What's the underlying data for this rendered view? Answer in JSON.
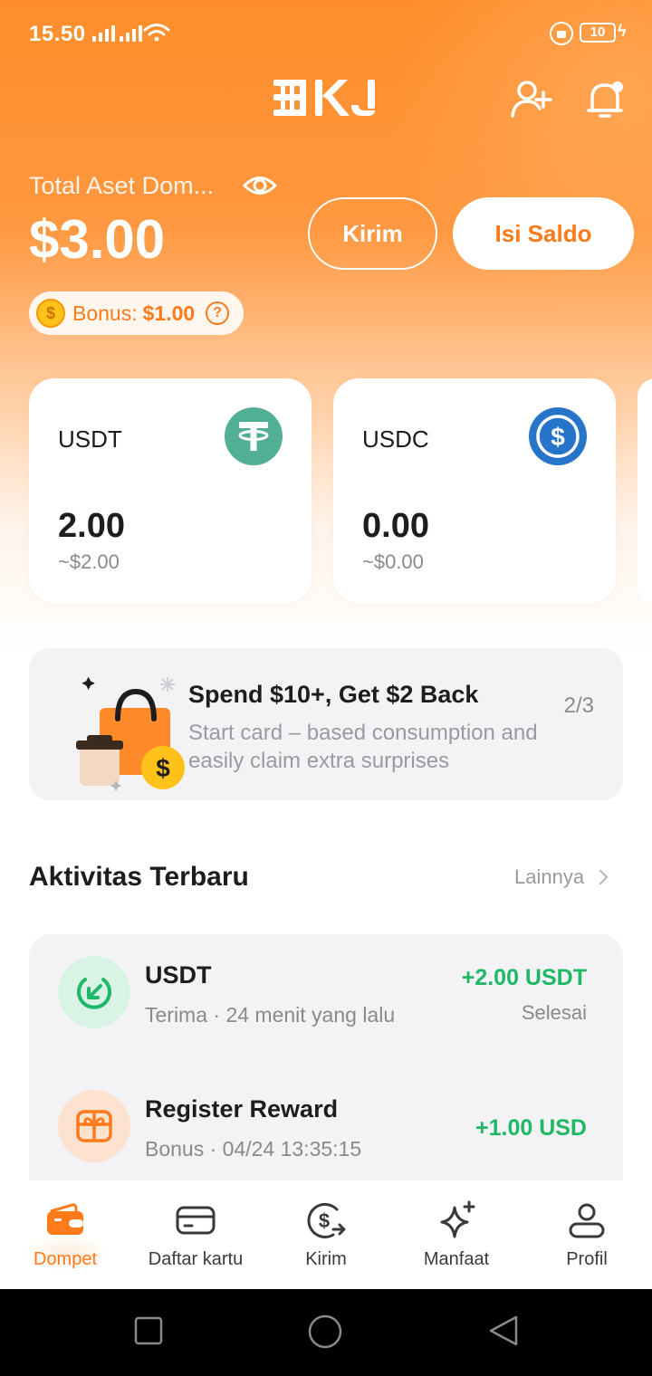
{
  "status_bar": {
    "time": "15.50",
    "battery": "10"
  },
  "header": {
    "logo_text": "BKJ",
    "add_user_icon": "add-user-icon",
    "bell_icon": "bell-icon"
  },
  "wallet": {
    "total_label": "Total Aset Dom...",
    "total_value": "$3.00",
    "send_label": "Kirim",
    "topup_label": "Isi Saldo",
    "bonus_label": "Bonus:",
    "bonus_value": "$1.00",
    "coin_symbol": "$",
    "help_symbol": "?"
  },
  "coins": [
    {
      "name": "USDT",
      "amount": "2.00",
      "usd": "~$2.00",
      "color": "#50af95"
    },
    {
      "name": "USDC",
      "amount": "0.00",
      "usd": "~$0.00",
      "color": "#2775ca"
    }
  ],
  "promo": {
    "title": "Spend $10+, Get $2 Back",
    "subtitle": "Start card – based consumption and easily claim extra surprises",
    "page": "2/3"
  },
  "activity": {
    "title": "Aktivitas Terbaru",
    "more_label": "Lainnya",
    "items": [
      {
        "title": "USDT",
        "subtitle": "Terima · 24 menit yang lalu",
        "amount": "+2.00 USDT",
        "status": "Selesai"
      },
      {
        "title": "Register Reward",
        "subtitle": "Bonus · 04/24 13:35:15",
        "amount": "+1.00 USD",
        "status": ""
      }
    ]
  },
  "nav": [
    {
      "label": "Dompet",
      "icon": "wallet-icon",
      "active": true
    },
    {
      "label": "Daftar kartu",
      "icon": "card-icon",
      "active": false
    },
    {
      "label": "Kirim",
      "icon": "send-money-icon",
      "active": false
    },
    {
      "label": "Manfaat",
      "icon": "sparkle-icon",
      "active": false
    },
    {
      "label": "Profil",
      "icon": "profile-icon",
      "active": false
    }
  ],
  "colors": {
    "accent": "#ff7a1a",
    "positive": "#1fb865"
  }
}
